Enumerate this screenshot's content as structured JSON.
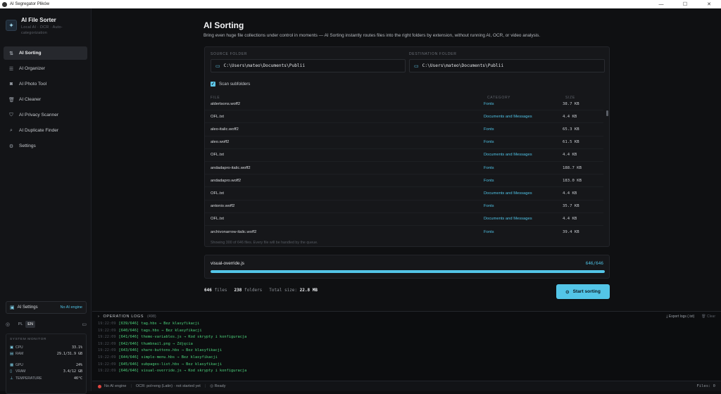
{
  "window": {
    "title": "AI Segregator Plików",
    "controls": [
      "—",
      "☐",
      "✕"
    ]
  },
  "brand": {
    "title": "AI File Sorter",
    "subtitle": "Local AI · OCR · Auto-categorization"
  },
  "sidebar": {
    "items": [
      {
        "label": "AI Sorting",
        "icon": "sort-icon",
        "glyph": "⇅",
        "active": true
      },
      {
        "label": "AI Organizer",
        "icon": "list-icon",
        "glyph": "☰",
        "active": false
      },
      {
        "label": "AI Photo Tool",
        "icon": "camera-icon",
        "glyph": "◙",
        "active": false
      },
      {
        "label": "AI Cleaner",
        "icon": "trash-icon",
        "glyph": "🗑",
        "active": false
      },
      {
        "label": "AI Privacy Scanner",
        "icon": "shield-icon",
        "glyph": "⛉",
        "active": false
      },
      {
        "label": "AI Duplicate Finder",
        "icon": "search-icon",
        "glyph": "⌕",
        "active": false
      },
      {
        "label": "Settings",
        "icon": "gear-icon",
        "glyph": "⚙",
        "active": false
      }
    ],
    "ai_settings": {
      "label": "AI Settings",
      "status": "No AI engine"
    },
    "languages": [
      "PL",
      "EN"
    ],
    "active_language": "EN",
    "system_monitor": {
      "title": "SYSTEM MONITOR",
      "rows": [
        {
          "label": "CPU",
          "value": "33.1%"
        },
        {
          "label": "RAM",
          "value": "29.1/31.9 GB"
        }
      ],
      "rows2": [
        {
          "label": "GPU",
          "value": "24%"
        },
        {
          "label": "VRAM",
          "value": "3.4/12 GB"
        },
        {
          "label": "TEMPERATURE",
          "value": "46°C"
        }
      ]
    }
  },
  "main": {
    "title": "AI Sorting",
    "description": "Bring even huge file collections under control in moments — AI Sorting instantly routes files into the right folders by extension, without running AI, OCR, or video analysis.",
    "source": {
      "label": "SOURCE FOLDER",
      "path": "C:\\Users\\mateo\\Documents\\Publii"
    },
    "destination": {
      "label": "DESTINATION FOLDER",
      "path": "C:\\Users\\mateo\\Documents\\Publii"
    },
    "scan_subfolders": "Scan subfolders",
    "table": {
      "headers": {
        "file": "FILE",
        "category": "CATEGORY",
        "size": "SIZE"
      },
      "rows": [
        {
          "file": "aldertsons.woff2",
          "category": "Fonts",
          "size": "38.7 KB"
        },
        {
          "file": "OFL.txt",
          "category": "Documents and Messages",
          "size": "4.4 KB"
        },
        {
          "file": "aleo-italic.woff2",
          "category": "Fonts",
          "size": "65.3 KB"
        },
        {
          "file": "aleo.woff2",
          "category": "Fonts",
          "size": "61.5 KB"
        },
        {
          "file": "OFL.txt",
          "category": "Documents and Messages",
          "size": "4.4 KB"
        },
        {
          "file": "andadapro-italic.woff2",
          "category": "Fonts",
          "size": "188.7 KB"
        },
        {
          "file": "andadapro.woff2",
          "category": "Fonts",
          "size": "183.0 KB"
        },
        {
          "file": "OFL.txt",
          "category": "Documents and Messages",
          "size": "4.4 KB"
        },
        {
          "file": "antonio.woff2",
          "category": "Fonts",
          "size": "35.7 KB"
        },
        {
          "file": "OFL.txt",
          "category": "Documents and Messages",
          "size": "4.4 KB"
        },
        {
          "file": "archivonarrow-italic.woff2",
          "category": "Fonts",
          "size": "39.4 KB"
        }
      ],
      "footer": "Showing 300 of 646 files. Every file will be handled by the queue."
    },
    "progress": {
      "current_file": "visual-override.js",
      "count": "646/646",
      "fraction": 1.0
    },
    "stats": {
      "files_value": "646",
      "files_label": "files",
      "folders_value": "238",
      "folders_label": "folders",
      "size_label": "Total size:",
      "size_value": "22.8 MB"
    },
    "start_button": "Start sorting"
  },
  "logs": {
    "title": "OPERATION LOGS",
    "count": "(498)",
    "export": "Export logs (.txt)",
    "clear": "Clear",
    "lines": [
      {
        "ts": "19:22:09",
        "msg": "[639/646] tag.hbs → Bez klasyfikacji"
      },
      {
        "ts": "19:22:09",
        "msg": "[640/646] tags.hbs → Bez klasyfikacji"
      },
      {
        "ts": "19:22:09",
        "msg": "[641/646] theme-variables.js → Kod skrypty i konfiguracja"
      },
      {
        "ts": "19:22:09",
        "msg": "[642/646] thumbnail.png → Zdjęcia"
      },
      {
        "ts": "19:22:09",
        "msg": "[643/646] share-buttons.hbs → Bez klasyfikacji"
      },
      {
        "ts": "19:22:09",
        "msg": "[644/646] simple-menu.hbs → Bez klasyfikacji"
      },
      {
        "ts": "19:22:09",
        "msg": "[645/646] subpages-list.hbs → Bez klasyfikacji"
      },
      {
        "ts": "19:22:09",
        "msg": "[646/646] visual-override.js → Kod skrypty i konfiguracja"
      }
    ]
  },
  "statusbar": {
    "engine": "No AI engine",
    "ocr": "OCR: pol+eng (Latin) · not started yet",
    "ready": "Ready",
    "files": "Files: 0"
  },
  "colors": {
    "accent": "#53c5e7",
    "log_green": "#4cd37c",
    "error_dot": "#e0453f"
  }
}
